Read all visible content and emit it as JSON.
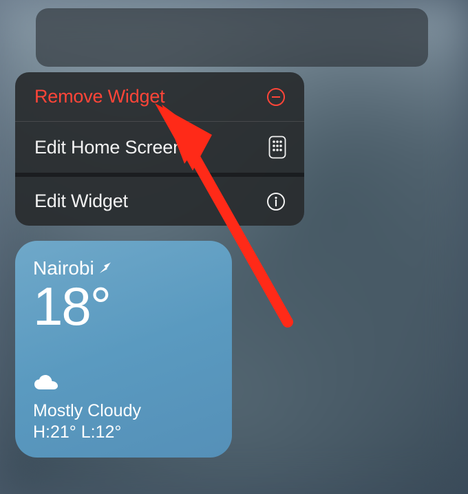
{
  "contextMenu": {
    "items": [
      {
        "label": "Remove Widget",
        "destructive": true
      },
      {
        "label": "Edit Home Screen",
        "destructive": false
      },
      {
        "label": "Edit Widget",
        "destructive": false
      }
    ]
  },
  "weather": {
    "location": "Nairobi",
    "temperature": "18°",
    "condition": "Mostly Cloudy",
    "high": "21°",
    "low": "12°",
    "hilo_text": "H:21° L:12°"
  },
  "colors": {
    "destructive": "#ff4538",
    "menuBg": "rgba(40,43,46,0.92)",
    "widgetGradientStart": "#6fa8c9",
    "widgetGradientEnd": "#5590b8",
    "arrow": "#ff2a18"
  }
}
